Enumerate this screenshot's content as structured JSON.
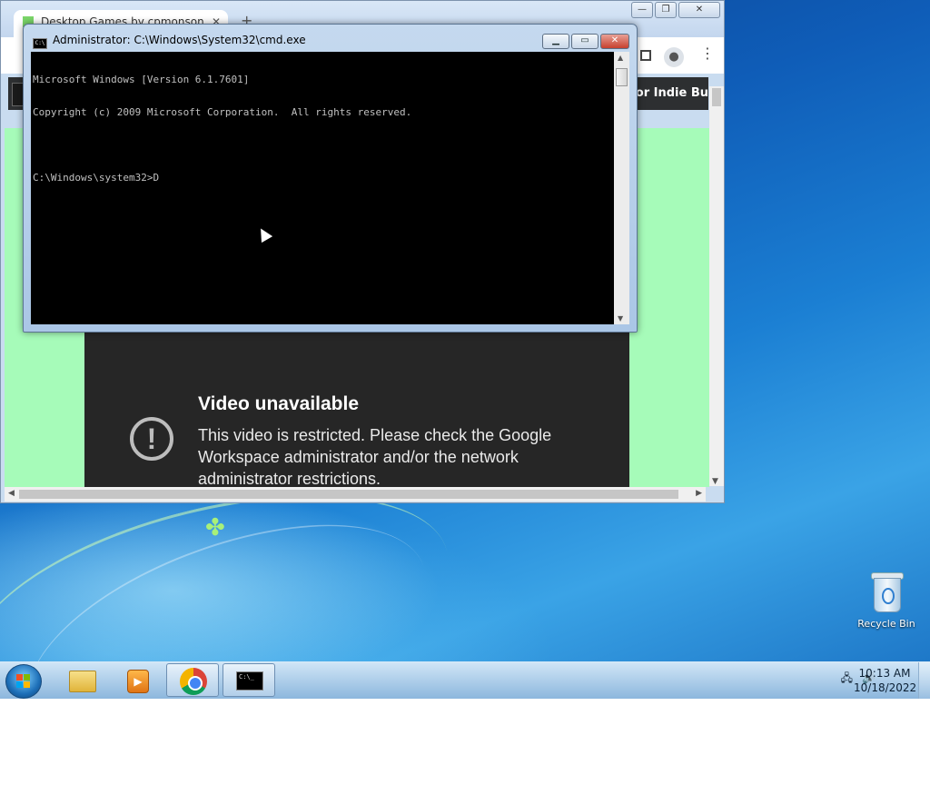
{
  "chrome": {
    "tab_title": "Desktop Games by cpmonson",
    "bookmark_text": "n for Indie Bu",
    "video": {
      "title": "Video unavailable",
      "message": "This video is restricted. Please check the Google Workspace administrator and/or the network administrator restrictions."
    }
  },
  "cmd": {
    "title": "Administrator: C:\\Windows\\System32\\cmd.exe",
    "lines": [
      "Microsoft Windows [Version 6.1.7601]",
      "Copyright (c) 2009 Microsoft Corporation.  All rights reserved.",
      "",
      "C:\\Windows\\system32>D"
    ]
  },
  "desktop": {
    "icons": [
      {
        "label": "Recycle Bin",
        "icon": "recycle-bin-icon"
      }
    ]
  },
  "taskbar": {
    "items": [
      {
        "name": "windows-explorer",
        "icon": "folder-icon"
      },
      {
        "name": "windows-media-player",
        "icon": "media-player-icon"
      },
      {
        "name": "google-chrome",
        "icon": "chrome-icon"
      },
      {
        "name": "command-prompt",
        "icon": "cmd-icon",
        "active": true
      }
    ],
    "clock": {
      "time": "10:13 AM",
      "date": "10/18/2022"
    }
  }
}
